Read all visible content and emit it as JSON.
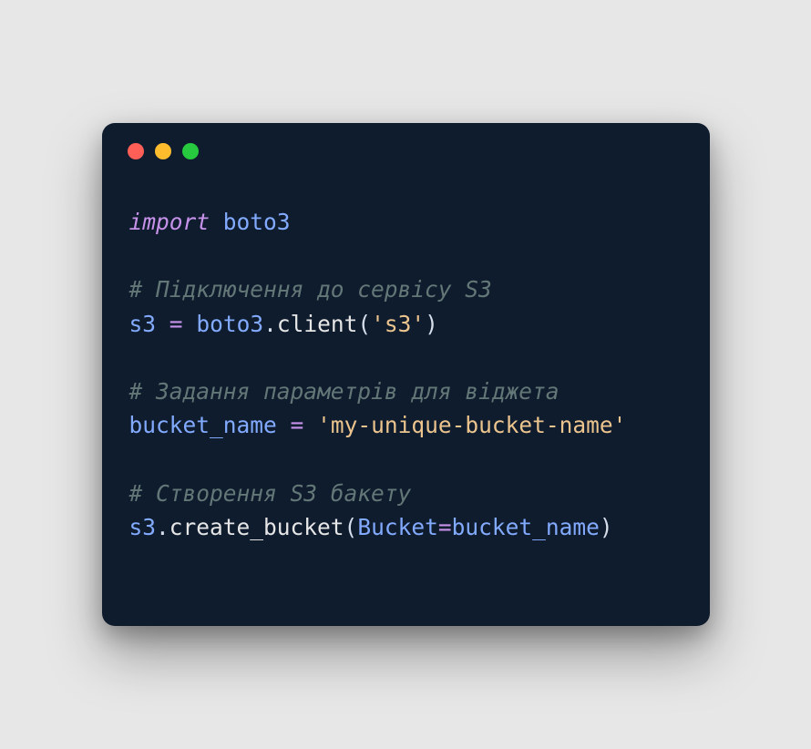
{
  "code": {
    "line1": {
      "import": "import",
      "module": "boto3"
    },
    "line3": {
      "comment": "# Підключення до сервісу S3"
    },
    "line4": {
      "var": "s3",
      "eq": "=",
      "mod": "boto3",
      "dot": ".",
      "func": "client",
      "lp": "(",
      "str": "'s3'",
      "rp": ")"
    },
    "line6": {
      "comment": "# Задання параметрів для віджета"
    },
    "line7": {
      "var": "bucket_name",
      "eq": "=",
      "str": "'my-unique-bucket-name'"
    },
    "line9": {
      "comment": "# Створення S3 бакету"
    },
    "line10": {
      "obj": "s3",
      "dot": ".",
      "func": "create_bucket",
      "lp": "(",
      "param": "Bucket",
      "eq": "=",
      "arg": "bucket_name",
      "rp": ")"
    }
  }
}
